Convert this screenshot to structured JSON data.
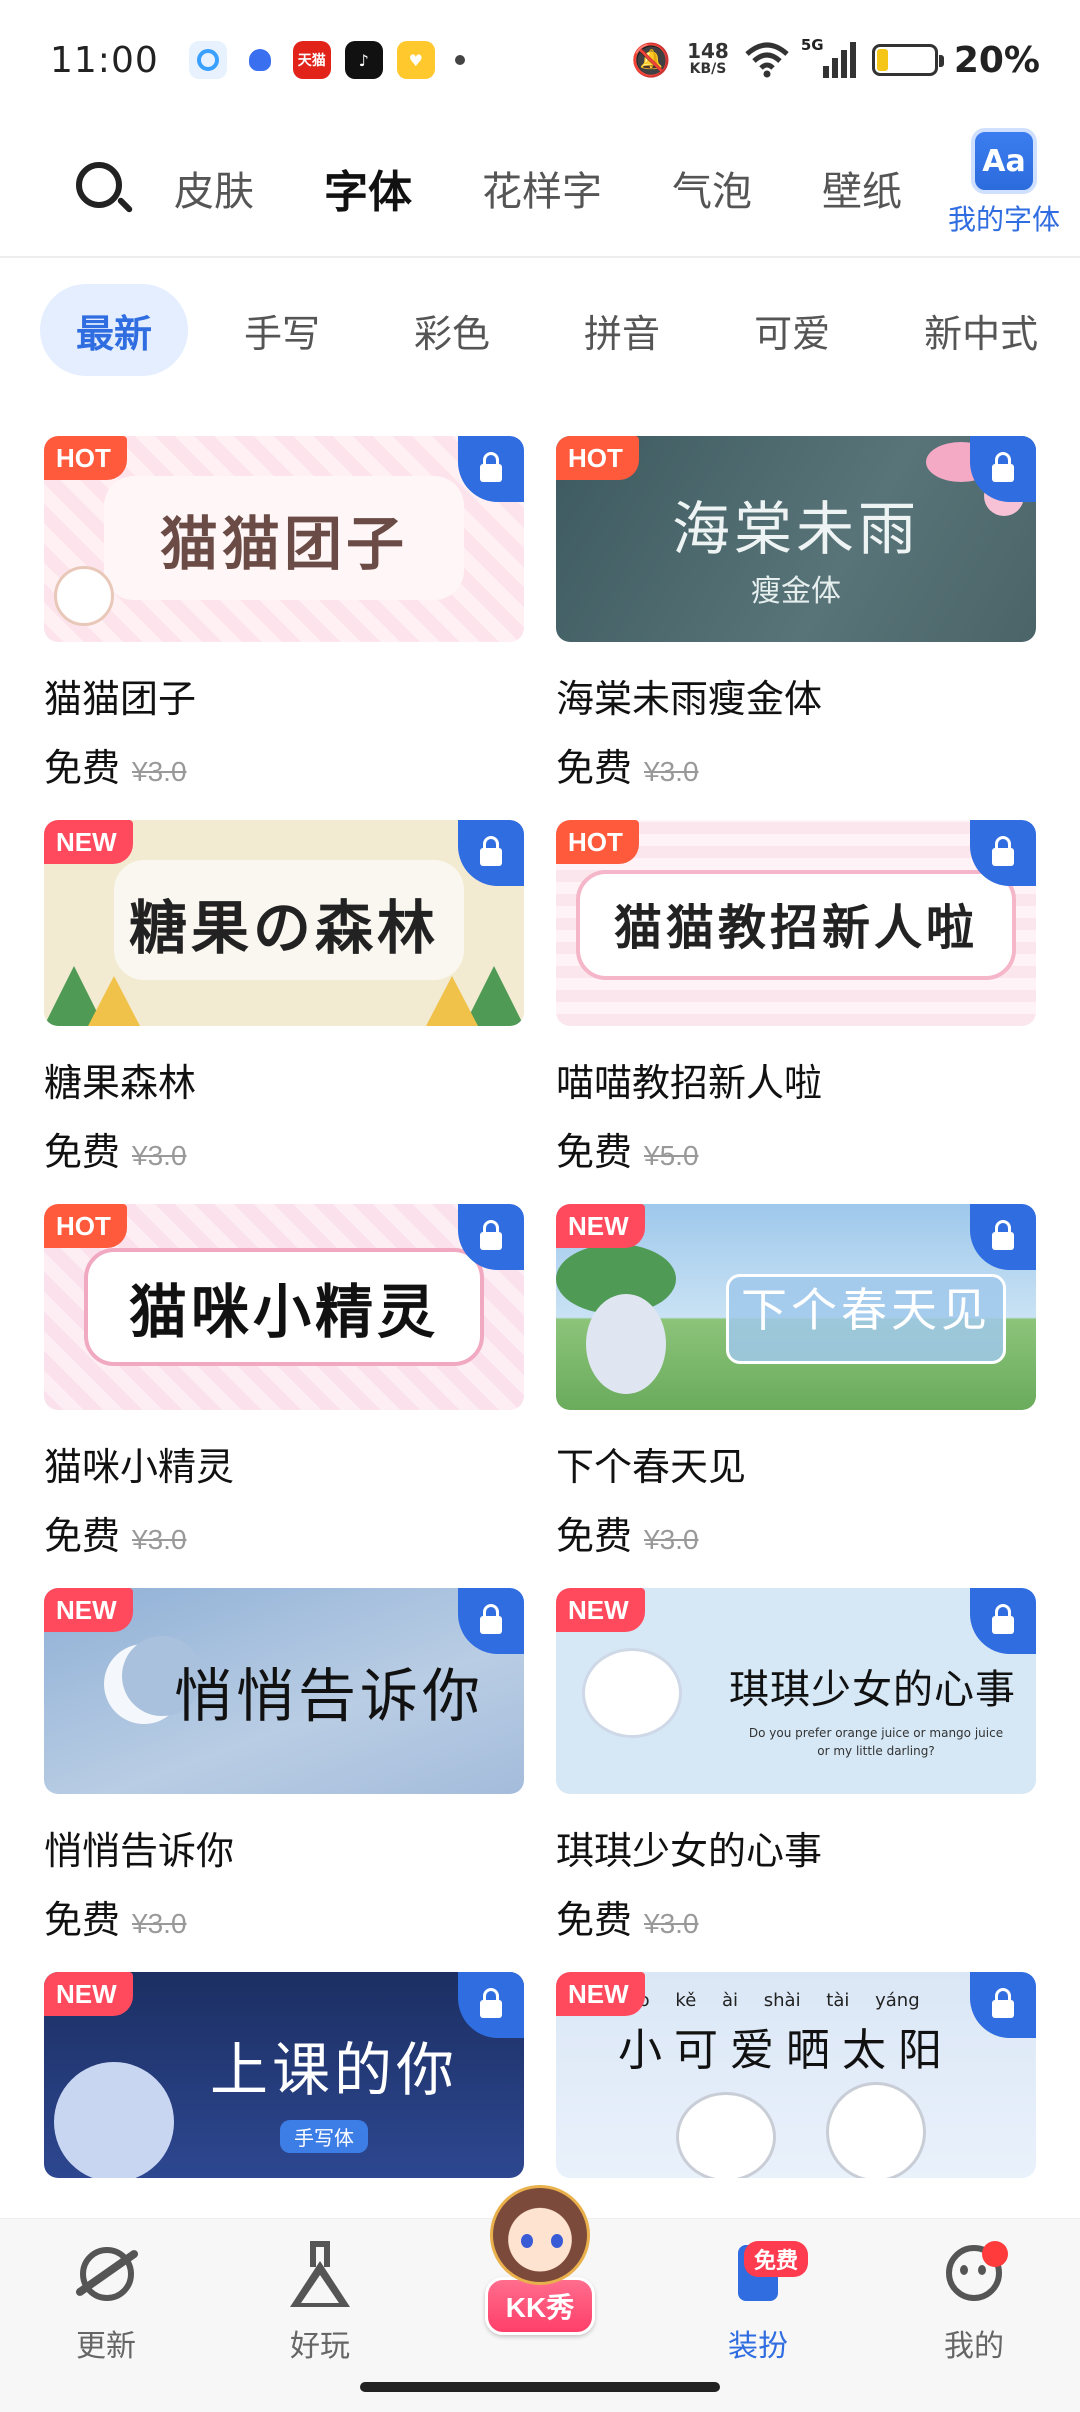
{
  "status_bar": {
    "time": "11:00",
    "app_icons": [
      "cloud-app-icon",
      "baidu-app-icon",
      "tmall-app-icon",
      "tiktok-app-icon",
      "yellow-app-icon"
    ],
    "tmall_label": "天猫",
    "net_speed_value": "148",
    "net_speed_unit": "KB/S",
    "network": "5G",
    "battery": "20%",
    "battery_level": 0.2
  },
  "top_nav": {
    "tabs": [
      "皮肤",
      "字体",
      "花样字",
      "气泡",
      "壁纸"
    ],
    "active_tab": "字体",
    "my_fonts_icon_text": "Aa",
    "my_fonts_label": "我的字体"
  },
  "categories": [
    "最新",
    "手写",
    "彩色",
    "拼音",
    "可爱",
    "新中式"
  ],
  "active_category": "最新",
  "fonts": [
    {
      "name": "猫猫团子",
      "badge": "HOT",
      "free": "免费",
      "original_price": "¥3.0",
      "preview_text": "猫猫团子",
      "preview_sub": ""
    },
    {
      "name": "海棠未雨瘦金体",
      "badge": "HOT",
      "free": "免费",
      "original_price": "¥3.0",
      "preview_text": "海棠未雨",
      "preview_sub": "瘦金体"
    },
    {
      "name": "糖果森林",
      "badge": "NEW",
      "free": "免费",
      "original_price": "¥3.0",
      "preview_text": "糖果の森林",
      "preview_sub": ""
    },
    {
      "name": "喵喵教招新人啦",
      "badge": "HOT",
      "free": "免费",
      "original_price": "¥5.0",
      "preview_text": "猫猫教招新人啦",
      "preview_sub": ""
    },
    {
      "name": "猫咪小精灵",
      "badge": "HOT",
      "free": "免费",
      "original_price": "¥3.0",
      "preview_text": "猫咪小精灵",
      "preview_sub": ""
    },
    {
      "name": "下个春天见",
      "badge": "NEW",
      "free": "免费",
      "original_price": "¥3.0",
      "preview_text": "下个春天见",
      "preview_sub": ""
    },
    {
      "name": "悄悄告诉你",
      "badge": "NEW",
      "free": "免费",
      "original_price": "¥3.0",
      "preview_text": "悄悄告诉你",
      "preview_sub": ""
    },
    {
      "name": "琪琪少女的心事",
      "badge": "NEW",
      "free": "免费",
      "original_price": "¥3.0",
      "preview_text": "琪琪少女的心事",
      "preview_sub": "Do you prefer orange juice or mango juice or my little darling?"
    },
    {
      "name": "",
      "badge": "NEW",
      "free": "",
      "original_price": "",
      "preview_text": "上课的你",
      "preview_sub": "手写体"
    },
    {
      "name": "",
      "badge": "NEW",
      "free": "",
      "original_price": "",
      "preview_text": "小可爱晒太阳",
      "preview_sub": "xiǎo kě ài shài tài yáng"
    }
  ],
  "bottom_nav": {
    "items": [
      "更新",
      "好玩",
      "KK秀",
      "装扮",
      "我的"
    ],
    "active": "装扮",
    "free_badge": "免费"
  },
  "colors": {
    "accent": "#2f6de0",
    "hot_badge": "#ff5a3c",
    "new_badge": "#ff4a5e",
    "tab_highlight": "#ffd94a"
  }
}
